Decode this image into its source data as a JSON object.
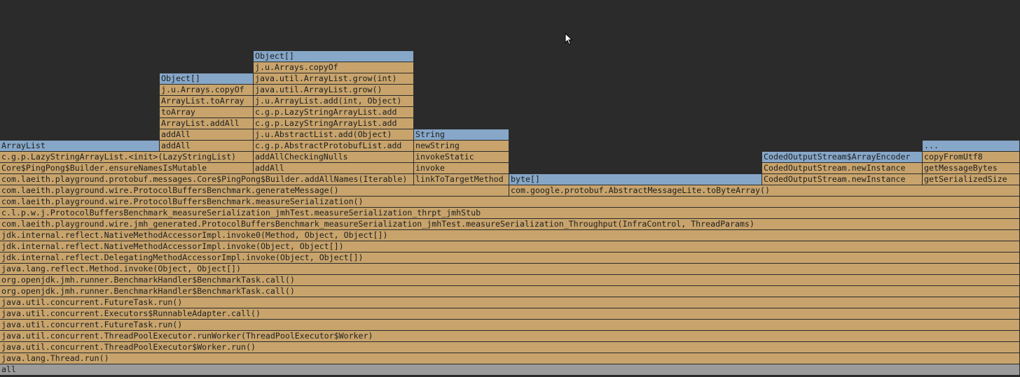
{
  "colors": {
    "background": "#2b2b2b",
    "method_frame": "#c8a46c",
    "allocation_frame": "#86a7c8",
    "root_frame": "#9b9b9b"
  },
  "frames": [
    {
      "label": "all",
      "kind": "root",
      "depth": 0,
      "start": 0,
      "end": 1456
    },
    {
      "label": "java.lang.Thread.run()",
      "kind": "method",
      "depth": 1,
      "start": 0,
      "end": 1456
    },
    {
      "label": "java.util.concurrent.ThreadPoolExecutor$Worker.run()",
      "kind": "method",
      "depth": 2,
      "start": 0,
      "end": 1456
    },
    {
      "label": "java.util.concurrent.ThreadPoolExecutor.runWorker(ThreadPoolExecutor$Worker)",
      "kind": "method",
      "depth": 3,
      "start": 0,
      "end": 1456
    },
    {
      "label": "java.util.concurrent.FutureTask.run()",
      "kind": "method",
      "depth": 4,
      "start": 0,
      "end": 1456
    },
    {
      "label": "java.util.concurrent.Executors$RunnableAdapter.call()",
      "kind": "method",
      "depth": 5,
      "start": 0,
      "end": 1456
    },
    {
      "label": "java.util.concurrent.FutureTask.run()",
      "kind": "method",
      "depth": 6,
      "start": 0,
      "end": 1456
    },
    {
      "label": "org.openjdk.jmh.runner.BenchmarkHandler$BenchmarkTask.call()",
      "kind": "method",
      "depth": 7,
      "start": 0,
      "end": 1456
    },
    {
      "label": "org.openjdk.jmh.runner.BenchmarkHandler$BenchmarkTask.call()",
      "kind": "method",
      "depth": 8,
      "start": 0,
      "end": 1456
    },
    {
      "label": "java.lang.reflect.Method.invoke(Object, Object[])",
      "kind": "method",
      "depth": 9,
      "start": 0,
      "end": 1456
    },
    {
      "label": "jdk.internal.reflect.DelegatingMethodAccessorImpl.invoke(Object, Object[])",
      "kind": "method",
      "depth": 10,
      "start": 0,
      "end": 1456
    },
    {
      "label": "jdk.internal.reflect.NativeMethodAccessorImpl.invoke(Object, Object[])",
      "kind": "method",
      "depth": 11,
      "start": 0,
      "end": 1456
    },
    {
      "label": "jdk.internal.reflect.NativeMethodAccessorImpl.invoke0(Method, Object, Object[])",
      "kind": "method",
      "depth": 12,
      "start": 0,
      "end": 1456
    },
    {
      "label": "com.laeith.playground.wire.jmh_generated.ProtocolBuffersBenchmark_measureSerialization_jmhTest.measureSerialization_Throughput(InfraControl, ThreadParams)",
      "kind": "method",
      "depth": 13,
      "start": 0,
      "end": 1456
    },
    {
      "label": "c.l.p.w.j.ProtocolBuffersBenchmark_measureSerialization_jmhTest.measureSerialization_thrpt_jmhStub",
      "kind": "method",
      "depth": 14,
      "start": 0,
      "end": 1456
    },
    {
      "label": "com.laeith.playground.wire.ProtocolBuffersBenchmark.measureSerialization()",
      "kind": "method",
      "depth": 15,
      "start": 0,
      "end": 1456
    },
    {
      "label": "com.laeith.playground.wire.ProtocolBuffersBenchmark.generateMessage()",
      "kind": "method",
      "depth": 16,
      "start": 0,
      "end": 727
    },
    {
      "label": "com.google.protobuf.AbstractMessageLite.toByteArray()",
      "kind": "method",
      "depth": 16,
      "start": 727,
      "end": 1456
    },
    {
      "label": "com.laeith.playground.protobuf.messages.Core$PingPong$Builder.addAllNames(Iterable)",
      "kind": "method",
      "depth": 17,
      "start": 0,
      "end": 591
    },
    {
      "label": "linkToTargetMethod",
      "kind": "method",
      "depth": 17,
      "start": 591,
      "end": 727
    },
    {
      "label": "byte[]",
      "kind": "alloc",
      "depth": 17,
      "start": 727,
      "end": 1088
    },
    {
      "label": "CodedOutputStream.newInstance",
      "kind": "method",
      "depth": 17,
      "start": 1088,
      "end": 1317
    },
    {
      "label": "getSerializedSize",
      "kind": "method",
      "depth": 17,
      "start": 1317,
      "end": 1456
    },
    {
      "label": "Core$PingPong$Builder.ensureNamesIsMutable",
      "kind": "method",
      "depth": 18,
      "start": 0,
      "end": 362
    },
    {
      "label": "addAll",
      "kind": "method",
      "depth": 18,
      "start": 362,
      "end": 591
    },
    {
      "label": "invoke",
      "kind": "method",
      "depth": 18,
      "start": 591,
      "end": 727
    },
    {
      "label": "CodedOutputStream.newInstance",
      "kind": "method",
      "depth": 18,
      "start": 1088,
      "end": 1317
    },
    {
      "label": "getMessageBytes",
      "kind": "method",
      "depth": 18,
      "start": 1317,
      "end": 1456
    },
    {
      "label": "c.g.p.LazyStringArrayList.<init>(LazyStringList)",
      "kind": "method",
      "depth": 19,
      "start": 0,
      "end": 362
    },
    {
      "label": "addAllCheckingNulls",
      "kind": "method",
      "depth": 19,
      "start": 362,
      "end": 591
    },
    {
      "label": "invokeStatic",
      "kind": "method",
      "depth": 19,
      "start": 591,
      "end": 727
    },
    {
      "label": "CodedOutputStream$ArrayEncoder",
      "kind": "alloc",
      "depth": 19,
      "start": 1088,
      "end": 1317
    },
    {
      "label": "copyFromUtf8",
      "kind": "method",
      "depth": 19,
      "start": 1317,
      "end": 1456
    },
    {
      "label": "ArrayList",
      "kind": "alloc",
      "depth": 20,
      "start": 0,
      "end": 228
    },
    {
      "label": "addAll",
      "kind": "method",
      "depth": 20,
      "start": 228,
      "end": 362
    },
    {
      "label": "c.g.p.AbstractProtobufList.add",
      "kind": "method",
      "depth": 20,
      "start": 362,
      "end": 591
    },
    {
      "label": "newString",
      "kind": "method",
      "depth": 20,
      "start": 591,
      "end": 727
    },
    {
      "label": "...",
      "kind": "alloc",
      "depth": 20,
      "start": 1317,
      "end": 1456
    },
    {
      "label": "addAll",
      "kind": "method",
      "depth": 21,
      "start": 228,
      "end": 362
    },
    {
      "label": "j.u.AbstractList.add(Object)",
      "kind": "method",
      "depth": 21,
      "start": 362,
      "end": 591
    },
    {
      "label": "String",
      "kind": "alloc",
      "depth": 21,
      "start": 591,
      "end": 727
    },
    {
      "label": "ArrayList.addAll",
      "kind": "method",
      "depth": 22,
      "start": 228,
      "end": 362
    },
    {
      "label": "c.g.p.LazyStringArrayList.add",
      "kind": "method",
      "depth": 22,
      "start": 362,
      "end": 591
    },
    {
      "label": "toArray",
      "kind": "method",
      "depth": 23,
      "start": 228,
      "end": 362
    },
    {
      "label": "c.g.p.LazyStringArrayList.add",
      "kind": "method",
      "depth": 23,
      "start": 362,
      "end": 591
    },
    {
      "label": "ArrayList.toArray",
      "kind": "method",
      "depth": 24,
      "start": 228,
      "end": 362
    },
    {
      "label": "j.u.ArrayList.add(int, Object)",
      "kind": "method",
      "depth": 24,
      "start": 362,
      "end": 591
    },
    {
      "label": "j.u.Arrays.copyOf",
      "kind": "method",
      "depth": 25,
      "start": 228,
      "end": 362
    },
    {
      "label": "java.util.ArrayList.grow()",
      "kind": "method",
      "depth": 25,
      "start": 362,
      "end": 591
    },
    {
      "label": "Object[]",
      "kind": "alloc",
      "depth": 26,
      "start": 228,
      "end": 362
    },
    {
      "label": "java.util.ArrayList.grow(int)",
      "kind": "method",
      "depth": 26,
      "start": 362,
      "end": 591
    },
    {
      "label": "j.u.Arrays.copyOf",
      "kind": "method",
      "depth": 27,
      "start": 362,
      "end": 591
    },
    {
      "label": "Object[]",
      "kind": "alloc",
      "depth": 28,
      "start": 362,
      "end": 591
    }
  ]
}
